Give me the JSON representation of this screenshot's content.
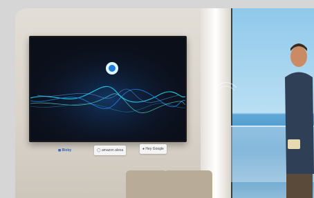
{
  "scene": {
    "type": "photo",
    "tv_screen": {
      "assistant_icon": "voice-assistant-icon"
    },
    "app_logos": [
      {
        "id": "bixby",
        "label": "Bixby",
        "icon": "bixby-icon"
      },
      {
        "id": "alexa",
        "label": "amazon alexa",
        "icon": "alexa-icon"
      },
      {
        "id": "google",
        "label": "Hey Google",
        "icon": "google-icon"
      }
    ],
    "colors": {
      "waveform_cyan": "#22d3ee",
      "waveform_blue": "#1e7bdc",
      "screen_bg": "#0b0f1a",
      "sea": "#3f8fc7",
      "sky": "#b9dff3"
    }
  }
}
